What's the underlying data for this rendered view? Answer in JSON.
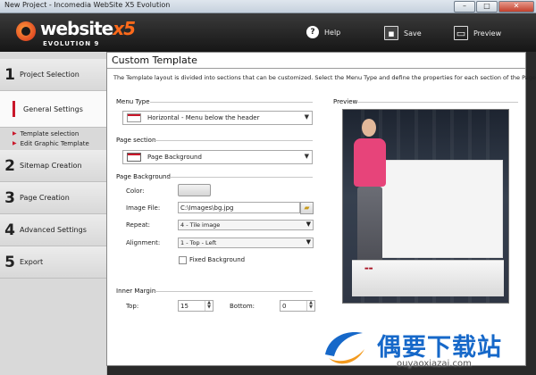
{
  "window": {
    "title": "New Project - Incomedia WebSite X5 Evolution",
    "controls": [
      "–",
      "□",
      "✕"
    ]
  },
  "brand": {
    "name": "website",
    "suffix": "x5",
    "edition": "EVOLUTION 9"
  },
  "toolbar": {
    "help": "Help",
    "save": "Save",
    "preview": "Preview"
  },
  "steps": [
    {
      "num": "1",
      "label": "Project Selection"
    },
    {
      "num": "",
      "label": "General Settings",
      "active": true
    },
    {
      "num": "2",
      "label": "Sitemap Creation"
    },
    {
      "num": "3",
      "label": "Page Creation"
    },
    {
      "num": "4",
      "label": "Advanced Settings"
    },
    {
      "num": "5",
      "label": "Export"
    }
  ],
  "substeps": [
    "Template selection",
    "Edit Graphic Template"
  ],
  "page": {
    "title": "Custom Template",
    "description": "The Template layout is divided into sections that can be customized. Select the Menu Type and define the properties for each section of the Page."
  },
  "menu_type": {
    "label": "Menu Type",
    "value": "Horizontal - Menu below the header"
  },
  "page_section": {
    "label": "Page section",
    "value": "Page Background"
  },
  "page_background": {
    "label": "Page Background",
    "color_label": "Color:",
    "image_label": "Image File:",
    "image_value": "C:\\Images\\bg.jpg",
    "repeat_label": "Repeat:",
    "repeat_value": "4 - Tile image",
    "alignment_label": "Alignment:",
    "alignment_value": "1 - Top - Left",
    "fixed_label": "Fixed Background"
  },
  "inner_margin": {
    "label": "Inner Margin",
    "top_label": "Top:",
    "top_value": "15",
    "bottom_label": "Bottom:",
    "bottom_value": "0"
  },
  "preview": {
    "label": "Preview"
  },
  "watermark": {
    "cn": "偶要下载站",
    "en": "ouyaoxiazai.com"
  }
}
